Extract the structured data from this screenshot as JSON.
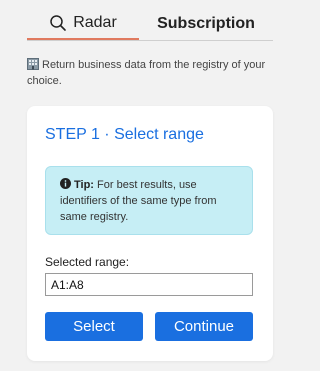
{
  "tabs": {
    "radar_label": "Radar",
    "subscription_label": "Subscription",
    "active": "Radar",
    "active_underline_color": "#e07a5f"
  },
  "description": {
    "text": "Return business data from the registry of your choice.",
    "icon": "building-icon"
  },
  "card": {
    "step_title": "STEP 1 · Select range",
    "tip": {
      "icon": "info-icon",
      "label": "Tip:",
      "text": " For best results, use identifiers of the same type from same registry."
    },
    "range_label": "Selected range:",
    "range_value": "A1:A8",
    "select_button": "Select",
    "continue_button": "Continue"
  },
  "colors": {
    "accent": "#1a6fe0",
    "tip_background": "#c6eef5",
    "page_background": "#f2f2f2"
  }
}
